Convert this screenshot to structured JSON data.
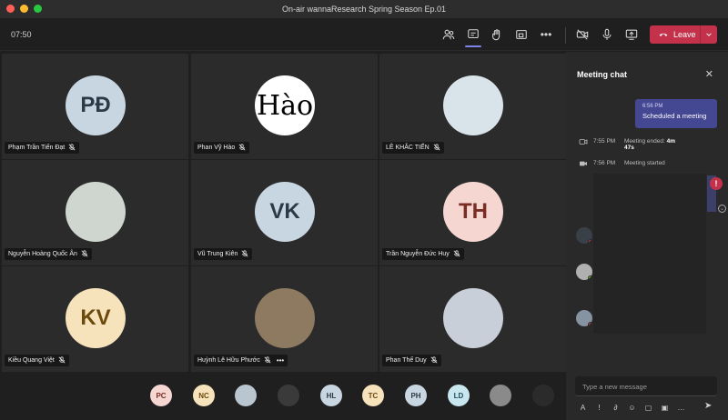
{
  "window": {
    "title": "On-air wannaResearch Spring Season Ep.01"
  },
  "toolbar": {
    "timer": "07:50",
    "leave_label": "Leave",
    "icons": [
      "participants-icon",
      "chat-icon",
      "raise-hand-icon",
      "share-tray-icon",
      "more-icon",
      "camera-off-icon",
      "mic-icon",
      "share-screen-icon"
    ]
  },
  "participants": [
    {
      "name": "Phạm Trần Tiến Đạt",
      "initials": "PĐ",
      "bg": "#c8d6e2",
      "fg": "#2b3a46"
    },
    {
      "name": "Phan Vỹ Hào",
      "initials": "Hào",
      "bg": "#ffffff",
      "fg": "#000000"
    },
    {
      "name": "LÊ KHẮC TIẾN",
      "initials": "",
      "bg": "#d8e3ea",
      "fg": "#333"
    },
    {
      "name": "Nguyễn Hoàng Quốc Ân",
      "initials": "",
      "bg": "#cfd6cf",
      "fg": "#333"
    },
    {
      "name": "Vũ Trung Kiên",
      "initials": "VK",
      "bg": "#c8d6e2",
      "fg": "#2b3a46"
    },
    {
      "name": "Trần Nguyễn Đức Huy",
      "initials": "TH",
      "bg": "#f5d6d0",
      "fg": "#7a2d25"
    },
    {
      "name": "Kiều Quang Việt",
      "initials": "KV",
      "bg": "#f7e3bb",
      "fg": "#6b4a0e"
    },
    {
      "name": "Huỳnh Lê Hữu Phước",
      "initials": "",
      "bg": "#8d7a60",
      "fg": "#333",
      "has_more": true
    },
    {
      "name": "Phan Thế Duy",
      "initials": "",
      "bg": "#c8cfd8",
      "fg": "#333"
    }
  ],
  "strip": [
    {
      "initials": "PC",
      "bg": "#f5d6d0",
      "fg": "#7a2d25"
    },
    {
      "initials": "NC",
      "bg": "#f7e3bb",
      "fg": "#6b4a0e"
    },
    {
      "initials": "",
      "bg": "#b9c6d0",
      "fg": "#333"
    },
    {
      "initials": "",
      "bg": "#3a3a3a",
      "fg": "#333"
    },
    {
      "initials": "HL",
      "bg": "#c8d6e2",
      "fg": "#2b3a46"
    },
    {
      "initials": "TC",
      "bg": "#f7e3bb",
      "fg": "#6b4a0e"
    },
    {
      "initials": "PH",
      "bg": "#c8d6e2",
      "fg": "#2b3a46"
    },
    {
      "initials": "LD",
      "bg": "#c8e6ee",
      "fg": "#1f4f5c"
    },
    {
      "initials": "",
      "bg": "#8a8a8a",
      "fg": "#333"
    },
    {
      "initials": "",
      "bg": "#2b2b2b",
      "fg": "#333"
    }
  ],
  "chat": {
    "title": "Meeting chat",
    "bubble_time": "6:56 PM",
    "bubble_text": "Scheduled a meeting",
    "ended_time": "7:55 PM",
    "ended_text": "Meeting ended: ",
    "ended_duration_1": "4m",
    "ended_duration_2": "47s",
    "started_time": "7:56 PM",
    "started_text": "Meeting started",
    "compose_placeholder": "Type a new message"
  },
  "colors": {
    "accent": "#7b83eb",
    "leave": "#c4314b",
    "bubble": "#444791"
  }
}
